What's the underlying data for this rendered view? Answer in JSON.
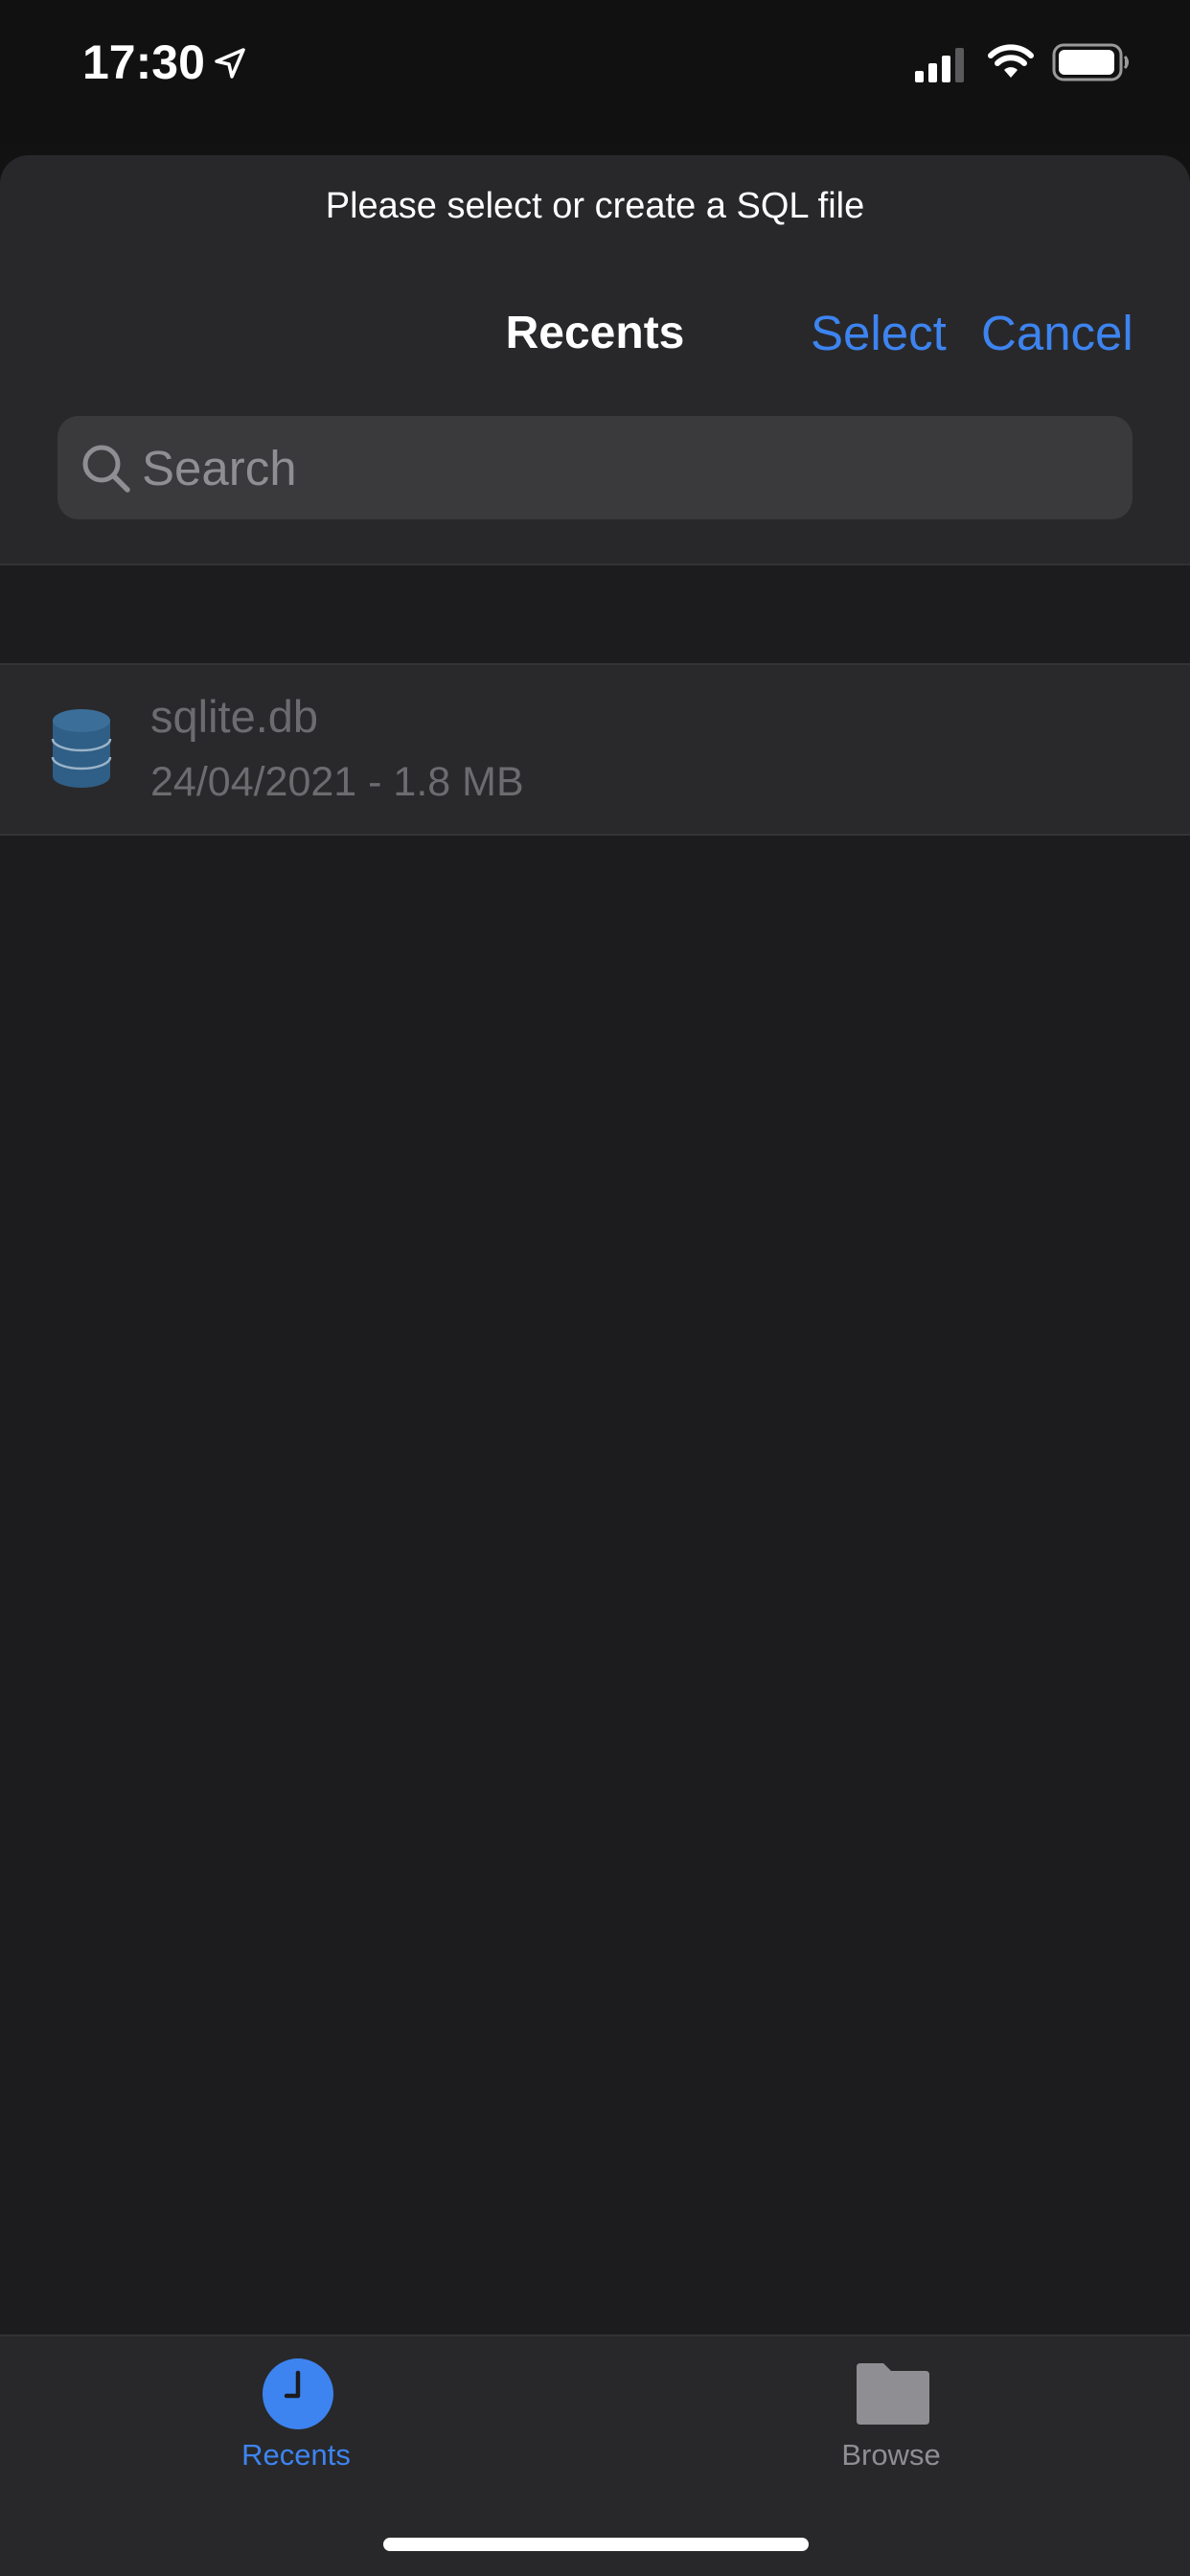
{
  "status_bar": {
    "time": "17:30",
    "icons": [
      "location-arrow-icon",
      "cellular-signal-icon",
      "wifi-icon",
      "battery-icon"
    ]
  },
  "sheet": {
    "prompt": "Please select or create a SQL file",
    "nav": {
      "title": "Recents",
      "select_label": "Select",
      "cancel_label": "Cancel"
    },
    "search": {
      "placeholder": "Search",
      "value": ""
    }
  },
  "files": [
    {
      "name": "sqlite.db",
      "meta": "24/04/2021 - 1.8 MB",
      "icon": "database-icon"
    }
  ],
  "tab_bar": {
    "tabs": [
      {
        "label": "Recents",
        "icon": "clock-icon",
        "selected": true
      },
      {
        "label": "Browse",
        "icon": "folder-icon",
        "selected": false
      }
    ]
  },
  "colors": {
    "accent": "#3d84f0",
    "background": "#1c1c1e",
    "header": "#28282a",
    "muted_text": "#6c6c70",
    "db_icon": "#2f5e86"
  }
}
